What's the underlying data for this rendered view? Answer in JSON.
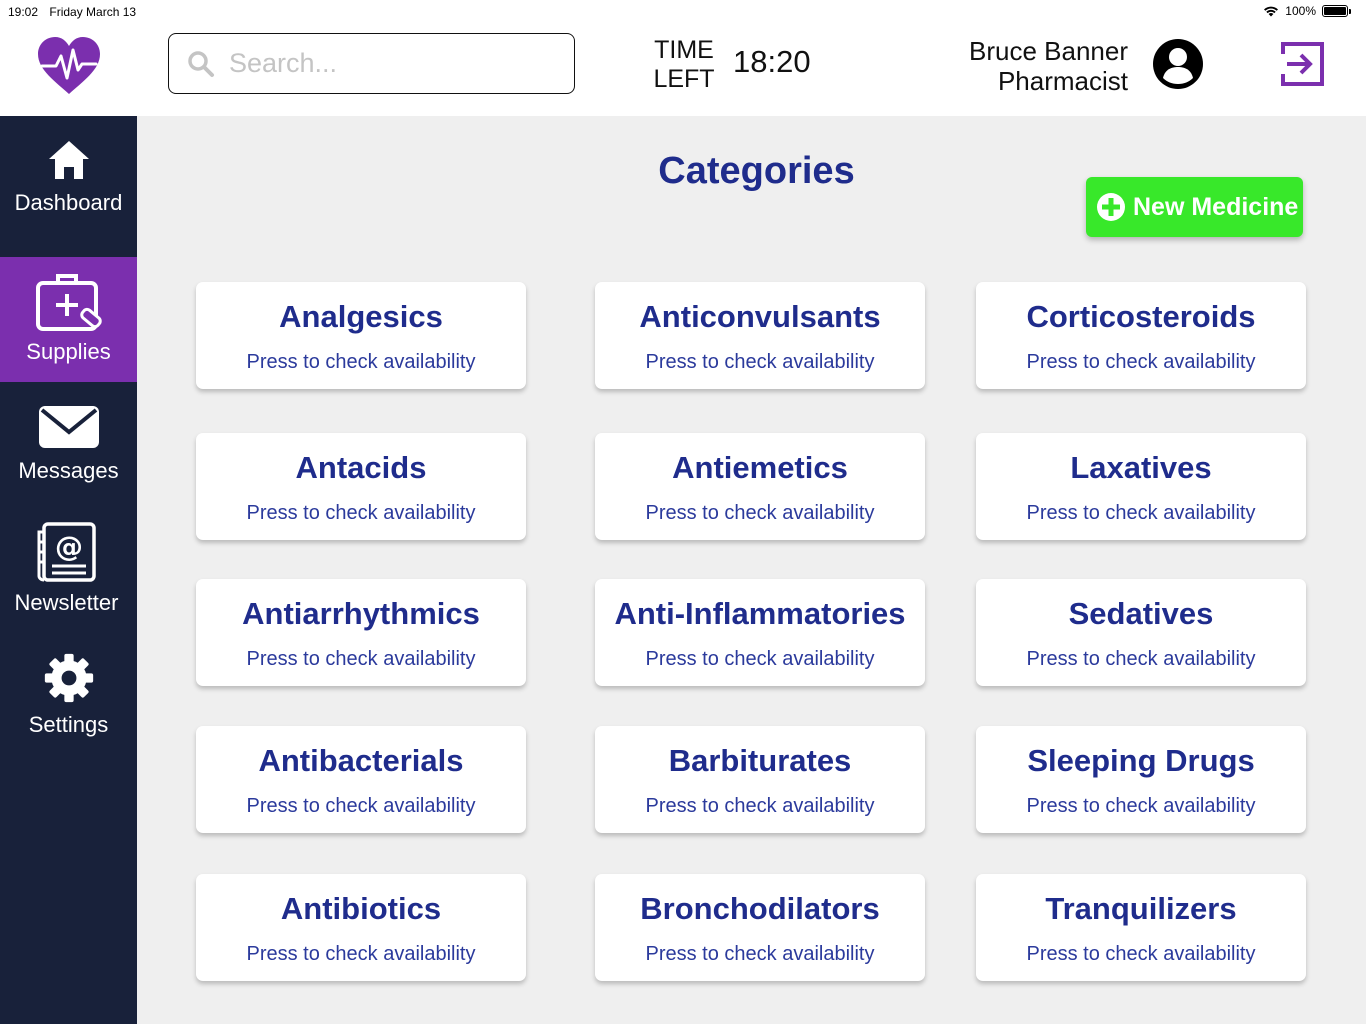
{
  "status_bar": {
    "time": "19:02",
    "date": "Friday March 13",
    "battery_text": "100%",
    "battery_level": 1.0
  },
  "header": {
    "search_placeholder": "Search...",
    "time_left_label_line1": "TIME",
    "time_left_label_line2": "LEFT",
    "time_left_value": "18:20",
    "user_name": "Bruce Banner",
    "user_role": "Pharmacist"
  },
  "colors": {
    "sidebar": "#18213a",
    "active_nav": "#7b2fae",
    "brand_purple": "#7b2fae",
    "title_blue": "#1f2c8c",
    "new_button": "#38e82a",
    "background": "#efefef"
  },
  "sidebar": {
    "items": [
      {
        "label": "Dashboard",
        "icon": "home-icon",
        "active": false
      },
      {
        "label": "Supplies",
        "icon": "medical-kit-icon",
        "active": true
      },
      {
        "label": "Messages",
        "icon": "envelope-icon",
        "active": false
      },
      {
        "label": "Newsletter",
        "icon": "newsletter-icon",
        "active": false
      },
      {
        "label": "Settings",
        "icon": "gear-icon",
        "active": false
      }
    ]
  },
  "main": {
    "title": "Categories",
    "new_button_label": "New Medicine",
    "card_subtitle": "Press to check availability",
    "categories": [
      "Analgesics",
      "Anticonvulsants",
      "Corticosteroids",
      "Antacids",
      "Antiemetics",
      "Laxatives",
      "Antiarrhythmics",
      "Anti-Inflammatories",
      "Sedatives",
      "Antibacterials",
      "Barbiturates",
      "Sleeping Drugs",
      "Antibiotics",
      "Bronchodilators",
      "Tranquilizers"
    ]
  }
}
